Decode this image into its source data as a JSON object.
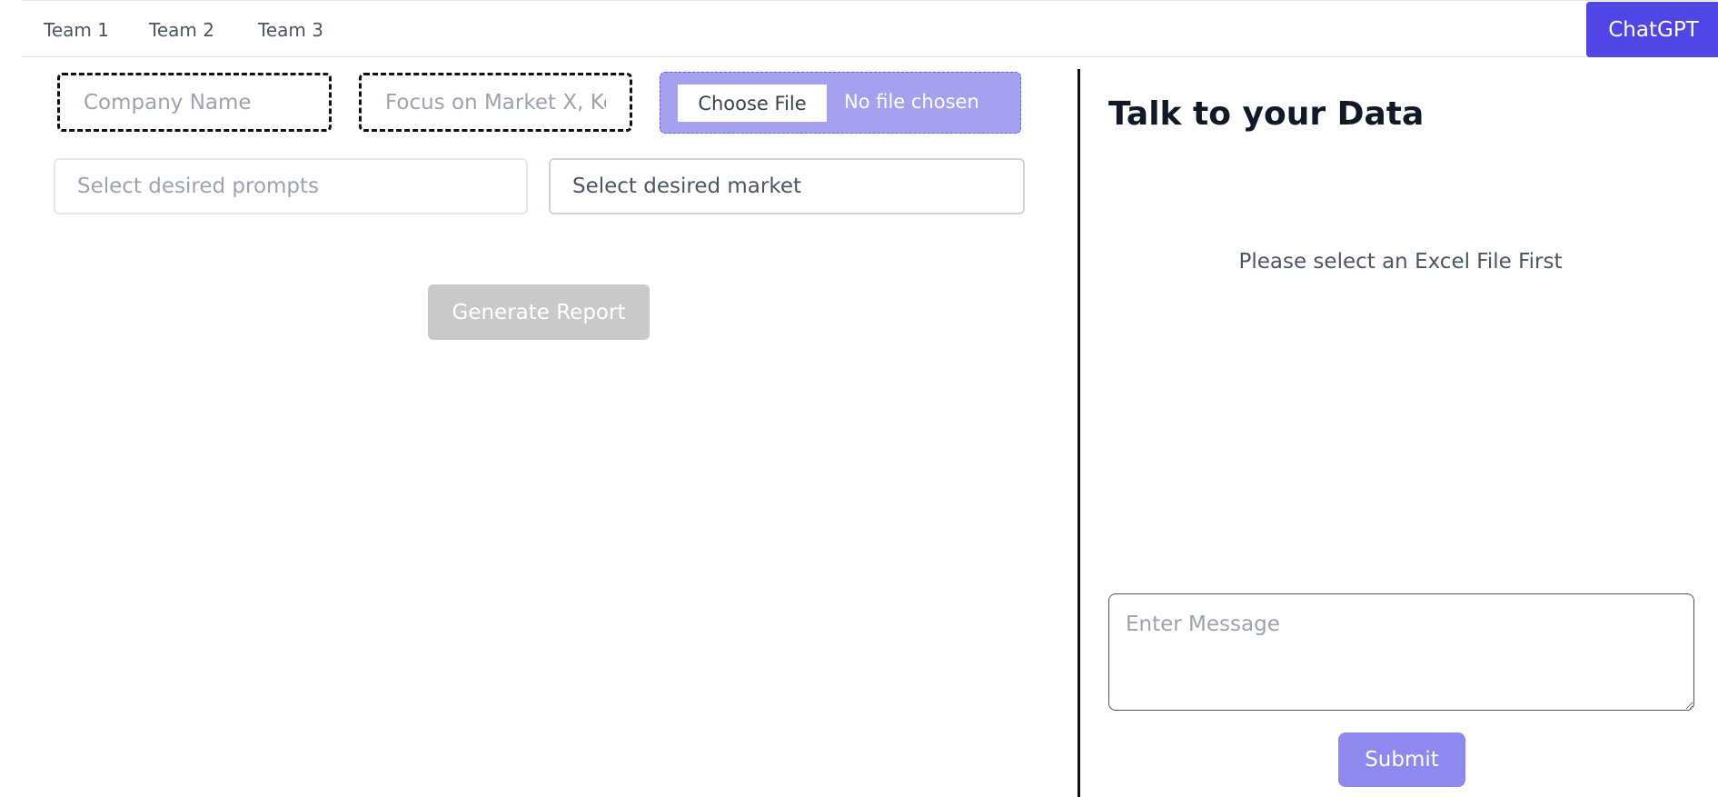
{
  "nav": {
    "tabs": [
      {
        "label": "Team 1"
      },
      {
        "label": "Team 2"
      },
      {
        "label": "Team 3"
      }
    ],
    "chatgpt_label": "ChatGPT"
  },
  "form": {
    "company_placeholder": "Company Name",
    "focus_placeholder": "Focus on Market X, Key",
    "file": {
      "choose_label": "Choose File",
      "status": "No file chosen"
    },
    "prompts_placeholder": "Select desired prompts",
    "market_selected": "Select desired market",
    "generate_label": "Generate Report"
  },
  "chat": {
    "title": "Talk to your Data",
    "empty_message": "Please select an Excel File First",
    "input_placeholder": "Enter Message",
    "submit_label": "Submit"
  },
  "colors": {
    "primary": "#4f46e5",
    "file_area": "#a5a1f0",
    "submit": "#8f88ee",
    "generate_disabled": "#c9c9c9"
  }
}
